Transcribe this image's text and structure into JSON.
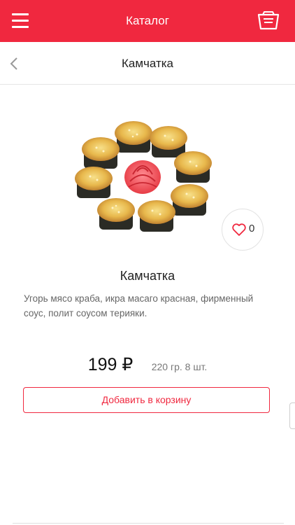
{
  "topbar": {
    "menu_icon": "hamburger-menu-icon",
    "title": "Каталог",
    "cart_icon": "basket-icon",
    "background_color": "#f0283f"
  },
  "subheader": {
    "back_icon": "chevron-left-icon",
    "title": "Камчатка"
  },
  "product": {
    "image_icon": "sushi-roll-plate-image",
    "likes": "0",
    "like_icon": "heart-outline-icon",
    "name": "Камчатка",
    "description": "Угорь мясо краба, икра масаго красная, фирменный соус, полит соусом терияки.",
    "price": "199 ₽",
    "weight": "220 гр. 8 шт.",
    "add_to_cart_label": "Добавить в корзину"
  }
}
